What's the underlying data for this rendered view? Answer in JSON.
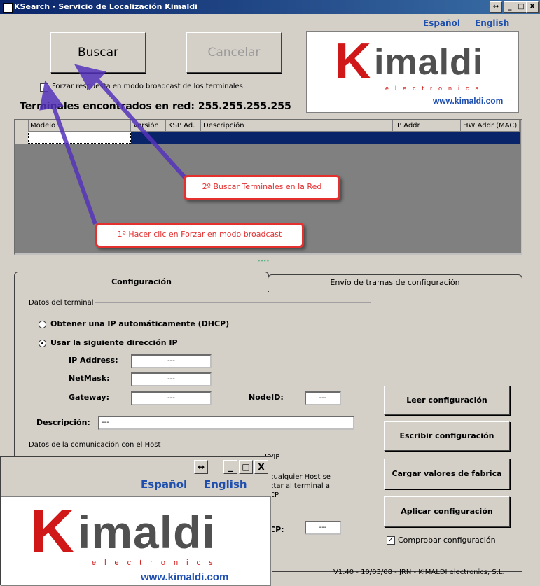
{
  "window": {
    "title": "KSearch - Servicio de Localización Kimaldi",
    "restore_icon": "restore-icon",
    "min_icon": "minimize-icon",
    "max_icon": "maximize-icon",
    "close_icon": "close-icon",
    "restore_glyph": "↔",
    "min_glyph": "_",
    "max_glyph": "□",
    "close_glyph": "X"
  },
  "lang": {
    "es": "Español",
    "en": "English"
  },
  "actions": {
    "buscar": "Buscar",
    "cancelar": "Cancelar"
  },
  "broadcast_label": "Forzar respuesta en modo broadcast de los terminales",
  "found_label": "Terminales encontrados en red: 255.255.255.255",
  "logo": {
    "k": "K",
    "word": "imaldi",
    "sub": "electronics",
    "url": "www.kimaldi.com"
  },
  "table": {
    "columns": [
      "Modelo",
      "Versión",
      "KSP Ad.",
      "Descripción",
      "IP Addr",
      "HW Addr (MAC)"
    ]
  },
  "callouts": {
    "step2": "2º Buscar Terminales en la Red",
    "step1": "1º Hacer clic en Forzar en modo broadcast"
  },
  "splitter": "----",
  "tabs": {
    "config": "Configuración",
    "envio": "Envío de tramas de configuración"
  },
  "terminal": {
    "group": "Datos del terminal",
    "dhcp": "Obtener una IP automáticamente (DHCP)",
    "static": "Usar la siguiente dirección IP",
    "ip_label": "IP Address:",
    "ip_value": "---",
    "mask_label": "NetMask:",
    "mask_value": "---",
    "gw_label": "Gateway:",
    "gw_value": "---",
    "node_label": "NodeID:",
    "node_value": "---",
    "desc_label": "Descripción:",
    "desc_value": "---"
  },
  "host": {
    "group": "Datos de la comunicación con el Host",
    "sub": "IP/IP",
    "text": "cualquier Host se\nctar al terminal a\nCP",
    "cp_label": "CP:",
    "cp_value": "---"
  },
  "buttons": {
    "leer": "Leer configuración",
    "escribir": "Escribir configuración",
    "cargar": "Cargar valores de fabrica",
    "aplicar": "Aplicar configuración"
  },
  "comprobar": {
    "label": "Comprobar configuración",
    "checked": true,
    "mark": "✓"
  },
  "status": "V1.40 - 10/03/08 - JRN - KIMALDI electronics, S.L."
}
